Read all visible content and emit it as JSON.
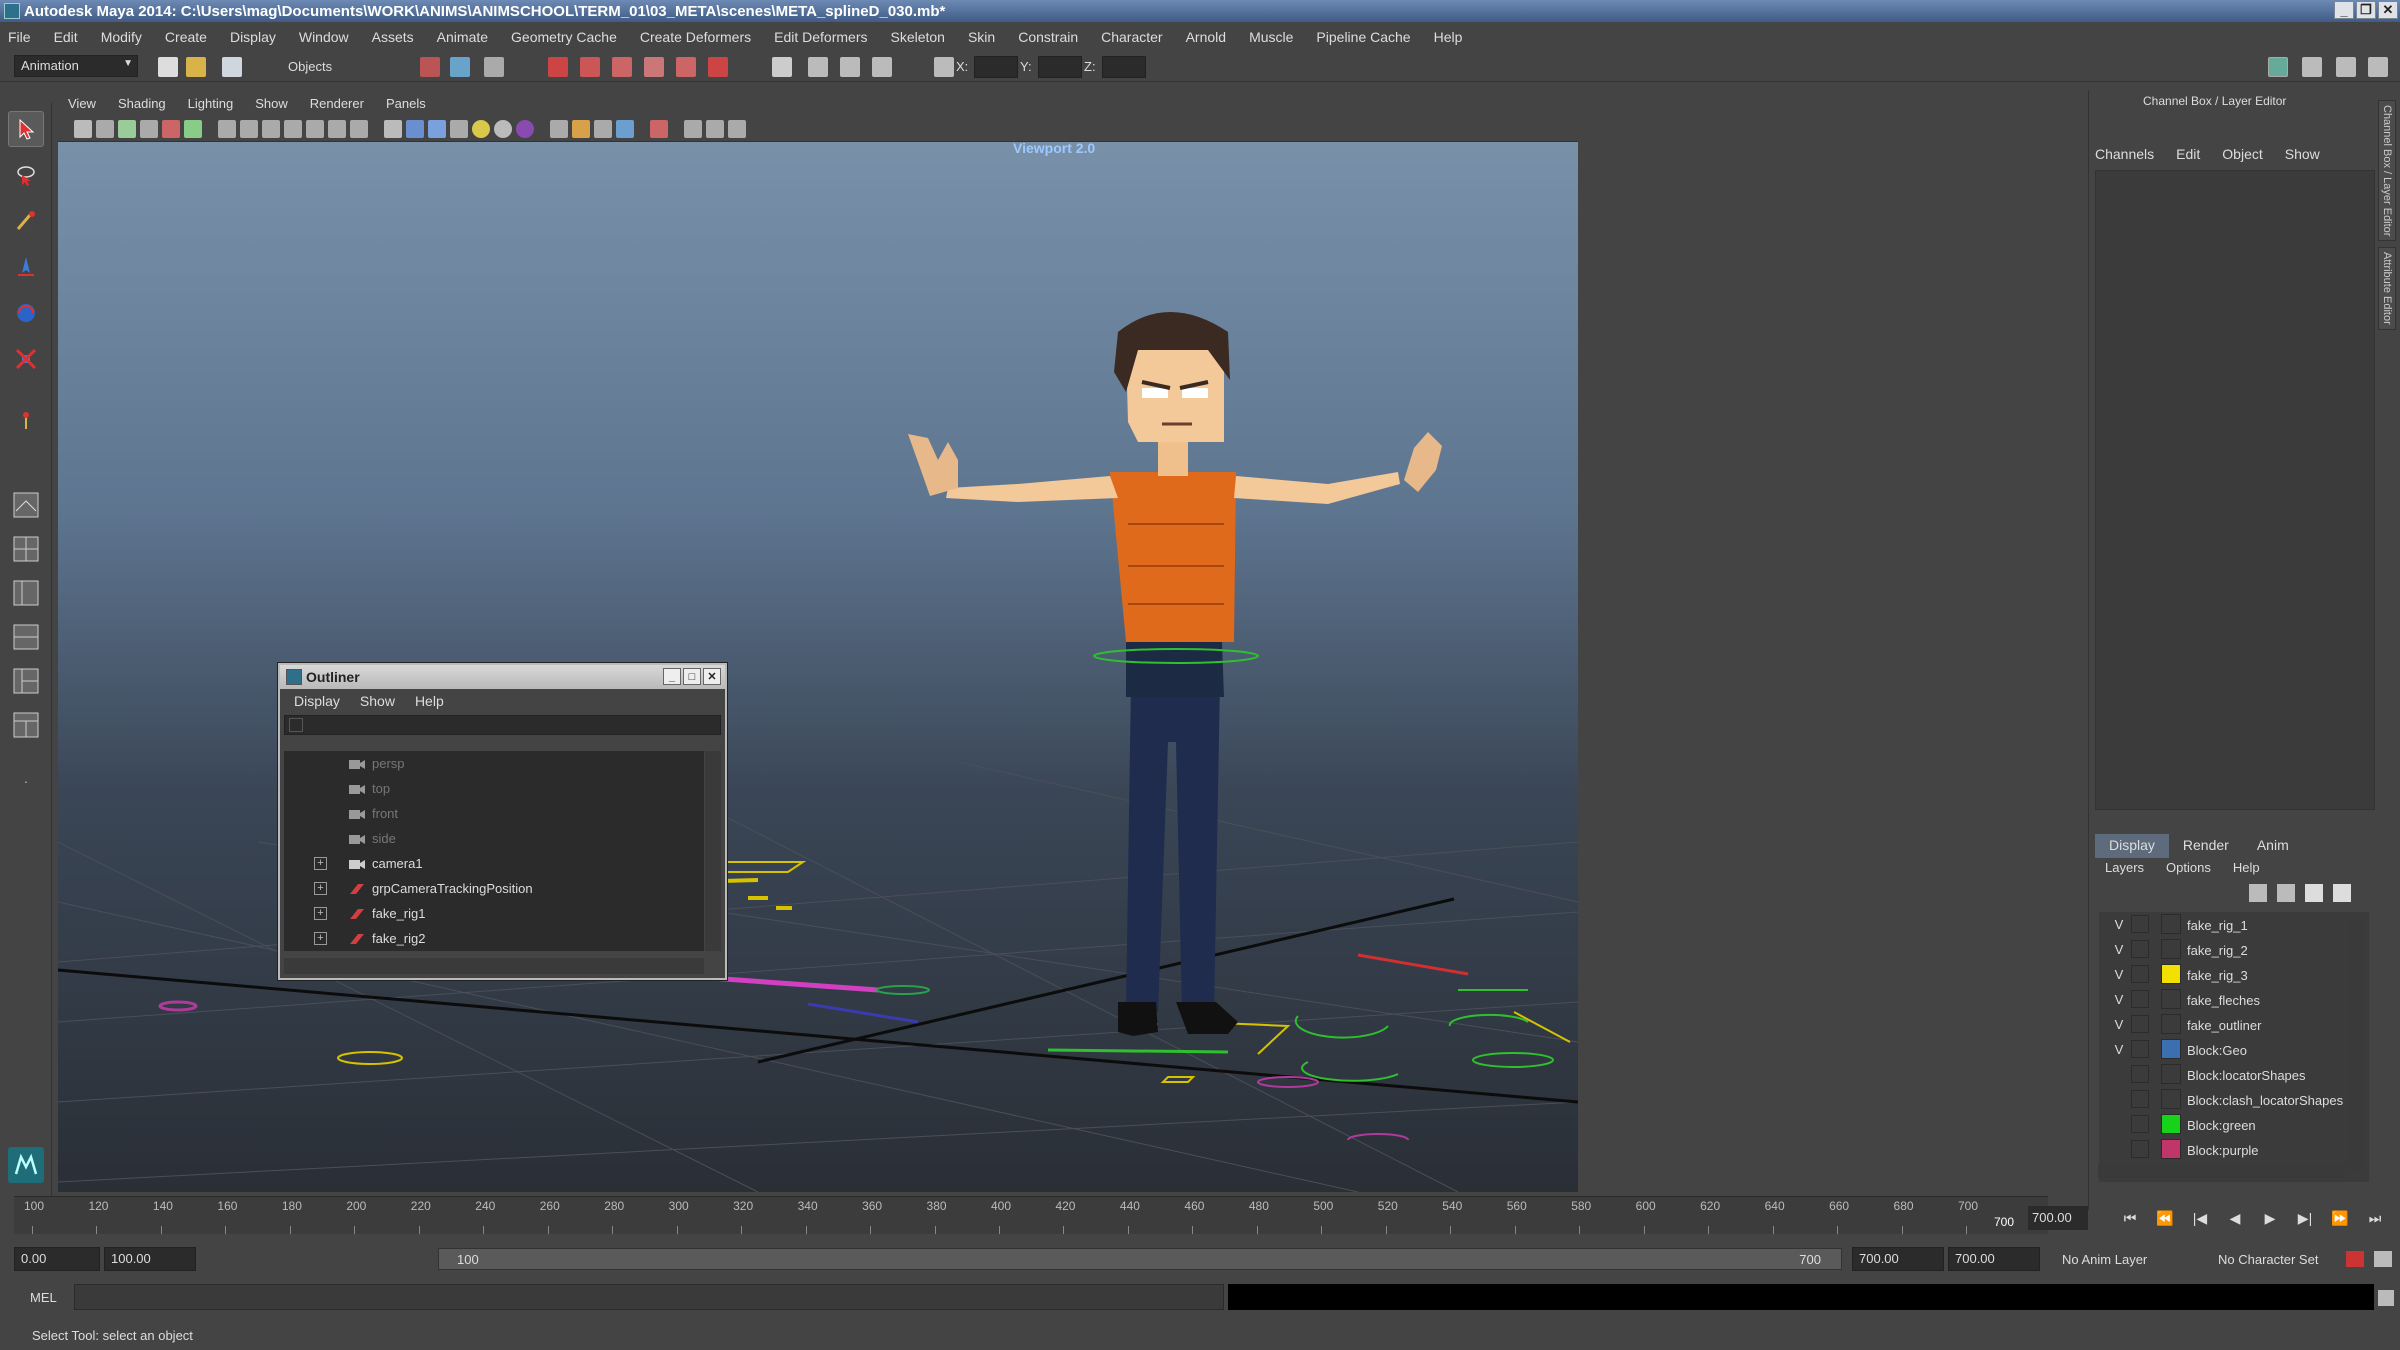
{
  "window": {
    "title": "Autodesk Maya 2014: C:\\Users\\mag\\Documents\\WORK\\ANIMS\\ANIMSCHOOL\\TERM_01\\03_META\\scenes\\META_splineD_030.mb*"
  },
  "menubar": [
    "File",
    "Edit",
    "Modify",
    "Create",
    "Display",
    "Window",
    "Assets",
    "Animate",
    "Geometry Cache",
    "Create Deformers",
    "Edit Deformers",
    "Skeleton",
    "Skin",
    "Constrain",
    "Character",
    "Arnold",
    "Muscle",
    "Pipeline Cache",
    "Help"
  ],
  "statusline": {
    "mode": "Animation",
    "selection_mask": "Objects",
    "x_label": "X:",
    "y_label": "Y:",
    "z_label": "Z:"
  },
  "viewport": {
    "menus": [
      "View",
      "Shading",
      "Lighting",
      "Show",
      "Renderer",
      "Panels"
    ],
    "label": "Viewport 2.0"
  },
  "outliner": {
    "title": "Outliner",
    "menus": [
      "Display",
      "Show",
      "Help"
    ],
    "items": [
      {
        "label": "persp",
        "dim": true,
        "expandable": false,
        "type": "camera"
      },
      {
        "label": "top",
        "dim": true,
        "expandable": false,
        "type": "camera"
      },
      {
        "label": "front",
        "dim": true,
        "expandable": false,
        "type": "camera"
      },
      {
        "label": "side",
        "dim": true,
        "expandable": false,
        "type": "camera"
      },
      {
        "label": "camera1",
        "dim": false,
        "expandable": true,
        "type": "camera"
      },
      {
        "label": "grpCameraTrackingPosition",
        "dim": false,
        "expandable": true,
        "type": "transform"
      },
      {
        "label": "fake_rig1",
        "dim": false,
        "expandable": true,
        "type": "transform"
      },
      {
        "label": "fake_rig2",
        "dim": false,
        "expandable": true,
        "type": "transform"
      }
    ]
  },
  "channelbox": {
    "title": "Channel Box / Layer Editor",
    "menus": [
      "Channels",
      "Edit",
      "Object",
      "Show"
    ]
  },
  "layer_editor": {
    "tabs": [
      "Display",
      "Render",
      "Anim"
    ],
    "active_tab": "Display",
    "menus": [
      "Layers",
      "Options",
      "Help"
    ],
    "layers": [
      {
        "name": "fake_rig_1",
        "visible": "V",
        "color": null
      },
      {
        "name": "fake_rig_2",
        "visible": "V",
        "color": null
      },
      {
        "name": "fake_rig_3",
        "visible": "V",
        "color": "#f2e000"
      },
      {
        "name": "fake_fleches",
        "visible": "V",
        "color": null
      },
      {
        "name": "fake_outliner",
        "visible": "V",
        "color": null
      },
      {
        "name": "Block:Geo",
        "visible": "V",
        "color": "#3c6fb0"
      },
      {
        "name": "Block:locatorShapes",
        "visible": "",
        "color": null
      },
      {
        "name": "Block:clash_locatorShapes",
        "visible": "",
        "color": null
      },
      {
        "name": "Block:green",
        "visible": "",
        "color": "#17d21b"
      },
      {
        "name": "Block:purple",
        "visible": "",
        "color": "#c0356a"
      }
    ]
  },
  "side_tabs": [
    "Channel Box / Layer Editor",
    "Attribute Editor"
  ],
  "timeslider": {
    "ticks": [
      "100",
      "120",
      "140",
      "160",
      "180",
      "200",
      "220",
      "240",
      "260",
      "280",
      "300",
      "320",
      "340",
      "360",
      "380",
      "400",
      "420",
      "440",
      "460",
      "480",
      "500",
      "520",
      "540",
      "560",
      "580",
      "600",
      "620",
      "640",
      "660",
      "680",
      "700"
    ],
    "current_frame": "700.00",
    "end_marker": "700"
  },
  "rangeslider": {
    "anim_start": "0.00",
    "playback_start": "100.00",
    "range_start_label": "100",
    "range_end_label": "700",
    "playback_end": "700.00",
    "anim_end": "700.00",
    "anim_layer": "No Anim Layer",
    "character_set": "No Character Set"
  },
  "cmdline": {
    "label": "MEL"
  },
  "helpline": {
    "text": "Select Tool: select an object"
  },
  "colors": {
    "accent": "#5d6b7c",
    "title_bar": "#3f5b86",
    "viewport_label": "#9ec8ff"
  }
}
